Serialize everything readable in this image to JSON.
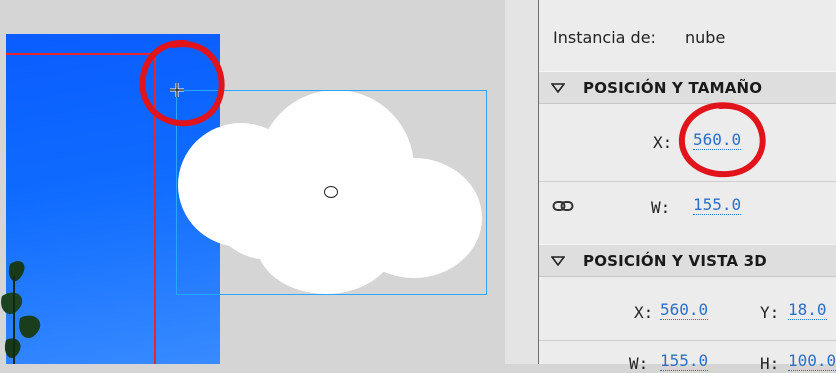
{
  "properties": {
    "instance_label": "Instancia de:",
    "instance_value": "nube",
    "section_position_size": "POSICIÓN Y TAMAÑO",
    "x_label": "X:",
    "x_value": "560.0",
    "w_label": "W:",
    "w_value": "155.0",
    "section_position_3d": "POSICIÓN Y VISTA 3D",
    "x3d_label": "X:",
    "x3d_value": "560.0",
    "y3d_label": "Y:",
    "y3d_value": "18.0",
    "w3d_label": "W:",
    "w3d_value": "155.0",
    "h3d_label": "H:",
    "h3d_value": "100.0"
  },
  "colors": {
    "stage_blue": "#0f6cff",
    "selection_box": "#2aa6ff",
    "annotation_red": "#e1141b",
    "link_value": "#2a6fc9"
  },
  "icons": {
    "crosshair": "crosshair-icon",
    "pivot": "transform-point-icon",
    "link": "link-icon",
    "collapse": "triangle-down-icon"
  }
}
